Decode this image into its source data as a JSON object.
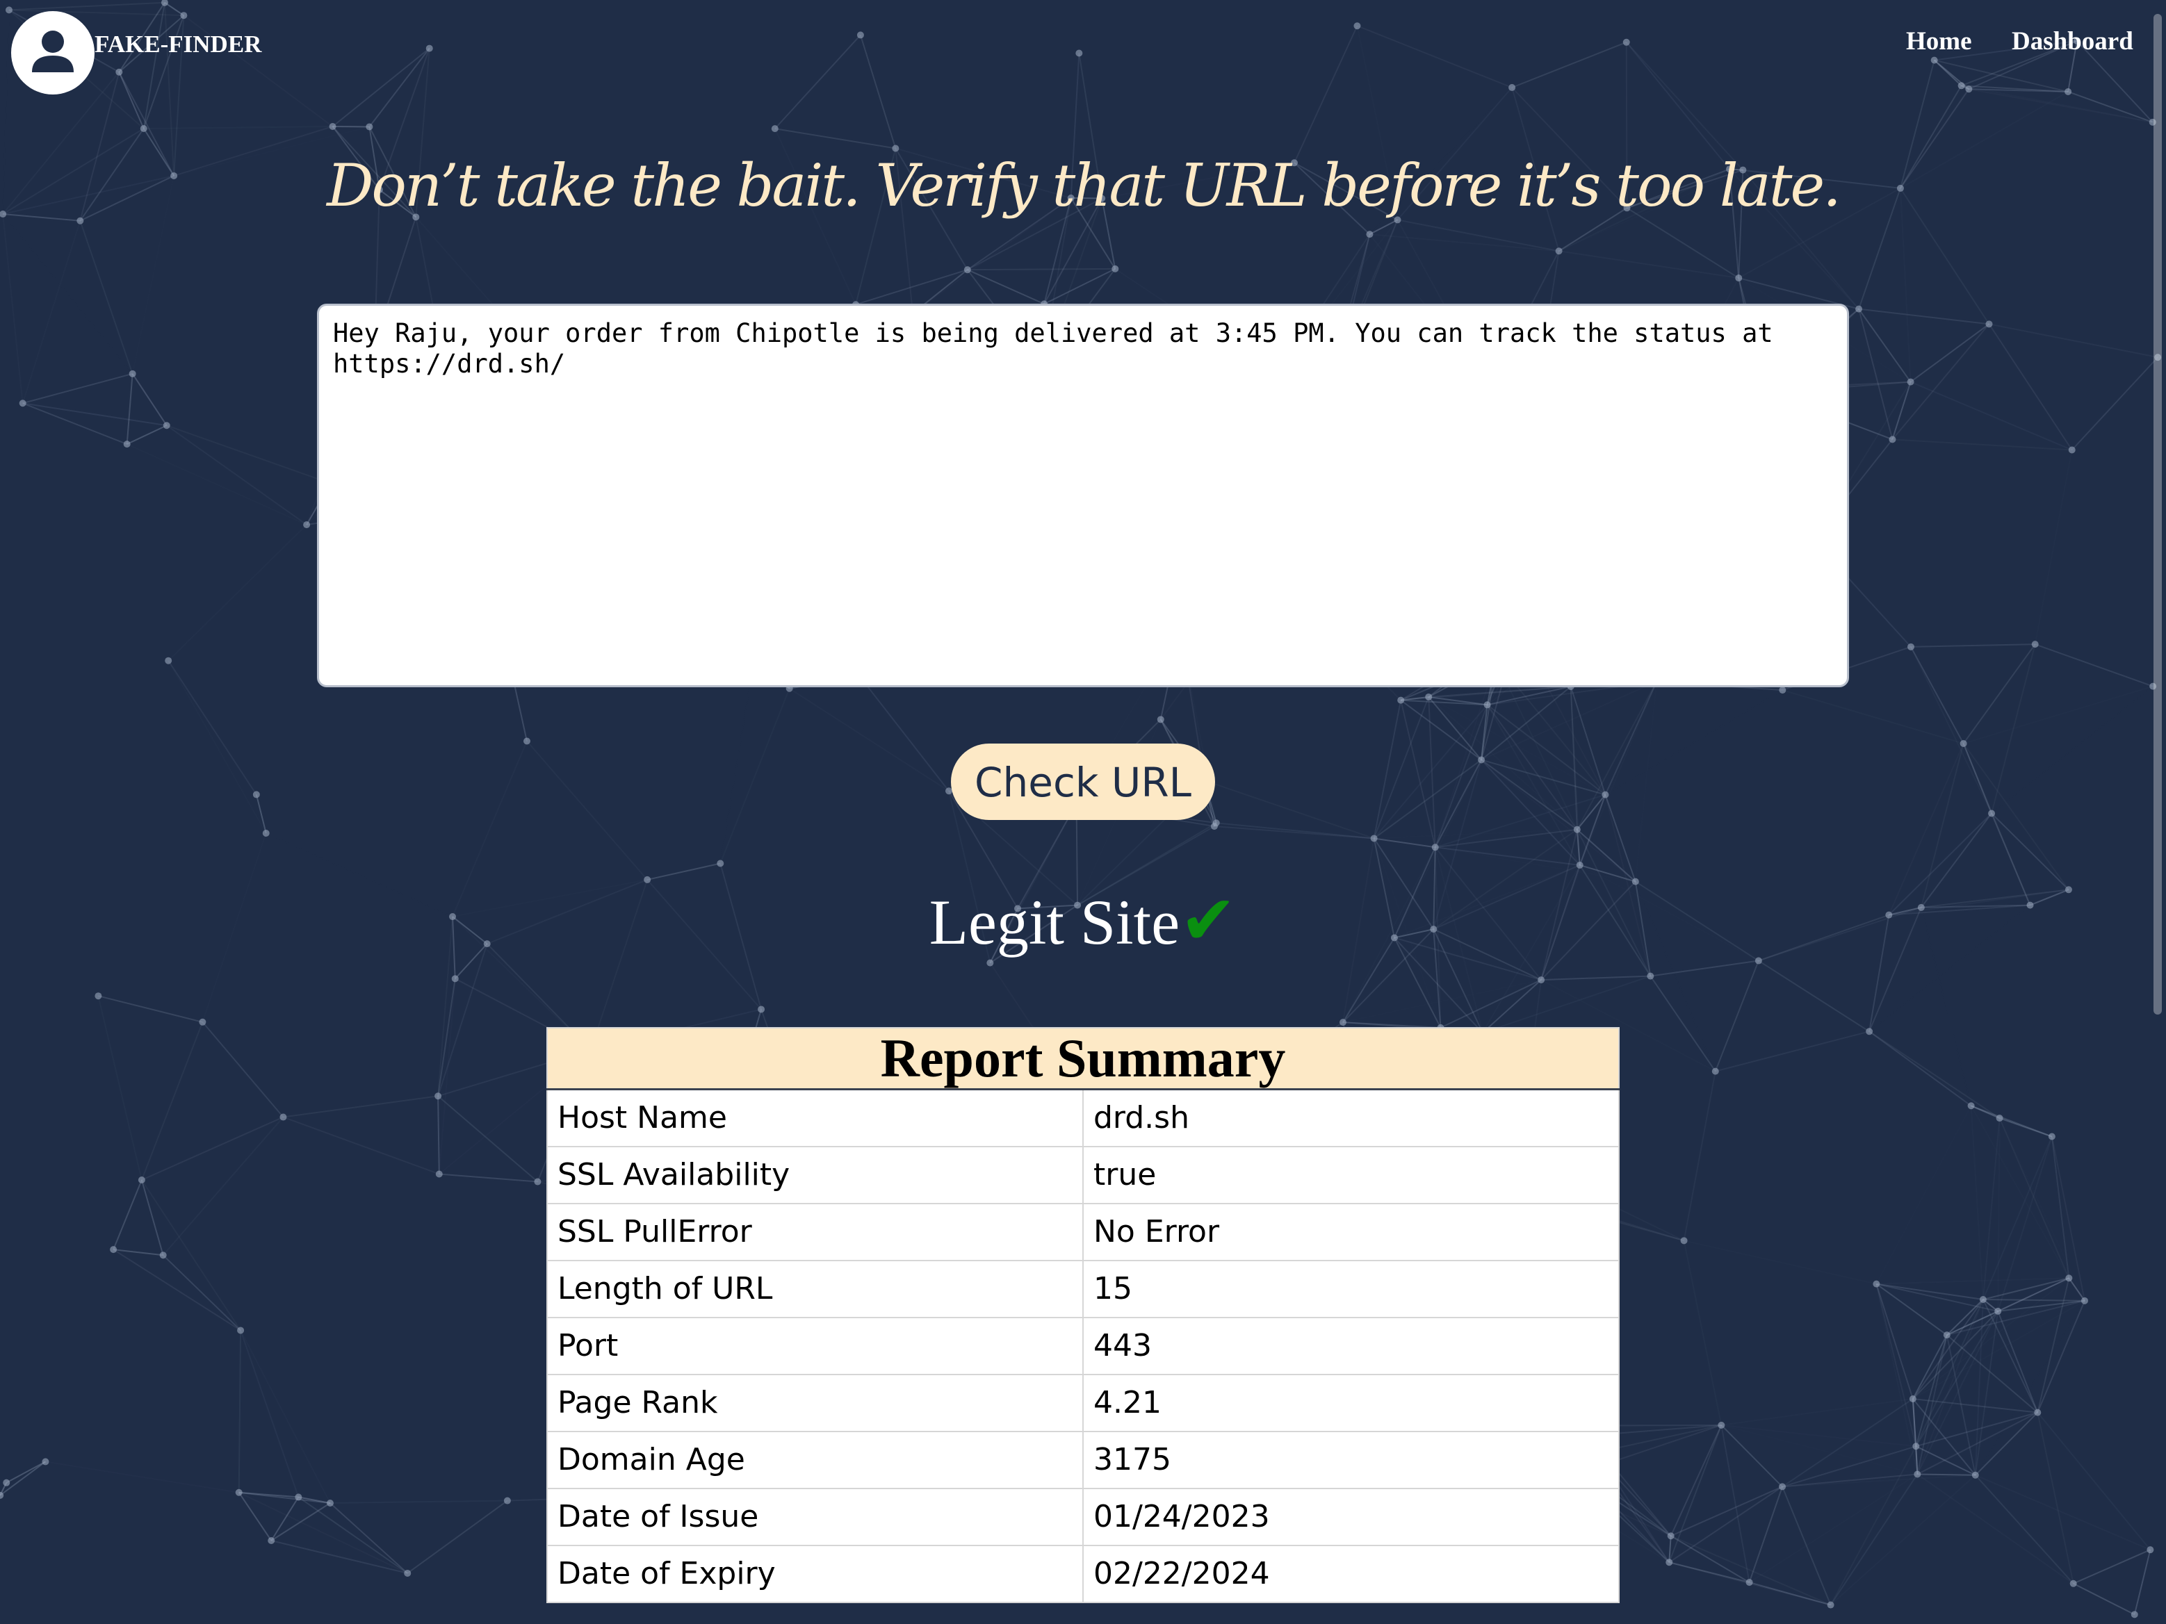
{
  "brand": {
    "name": "FAKE-FINDER",
    "logo_icon": "user-avatar-icon"
  },
  "nav": {
    "home": "Home",
    "dashboard": "Dashboard"
  },
  "headline": "Don’t take the bait. Verify that URL before it’s too late.",
  "message_input": {
    "value": "Hey Raju, your order from Chipotle is being delivered at 3:45 PM. You can track the status at https://drd.sh/"
  },
  "check_button": "Check URL",
  "verdict": {
    "text": "Legit Site",
    "icon": "checkmark-icon",
    "icon_color": "#0a8f10"
  },
  "report": {
    "title": "Report Summary",
    "rows": [
      {
        "label": "Host Name",
        "value": "drd.sh"
      },
      {
        "label": "SSL Availability",
        "value": "true"
      },
      {
        "label": "SSL PullError",
        "value": "No Error"
      },
      {
        "label": "Length of URL",
        "value": "15"
      },
      {
        "label": "Port",
        "value": "443"
      },
      {
        "label": "Page Rank",
        "value": "4.21"
      },
      {
        "label": "Domain Age",
        "value": "3175"
      },
      {
        "label": "Date of Issue",
        "value": "01/24/2023"
      },
      {
        "label": "Date of Expiry",
        "value": "02/22/2024"
      }
    ]
  },
  "colors": {
    "background": "#1f2d47",
    "accent": "#fde9c6",
    "success": "#0a8f10"
  }
}
